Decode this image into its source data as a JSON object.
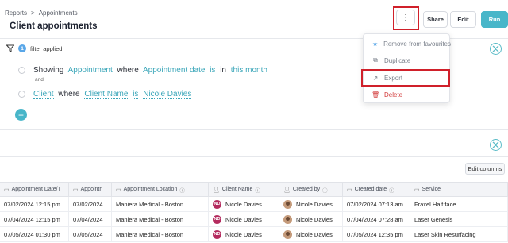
{
  "breadcrumb": {
    "parent": "Reports",
    "separator": ">",
    "current": "Appointments"
  },
  "page": {
    "title": "Client appointments"
  },
  "toolbar": {
    "more_label": "⋮",
    "share_label": "Share",
    "edit_label": "Edit",
    "run_label": "Run"
  },
  "menu": {
    "items": [
      {
        "label": "Remove from favourites",
        "icon": "star-icon"
      },
      {
        "label": "Duplicate",
        "icon": "copy-icon"
      },
      {
        "label": "Export",
        "icon": "export-icon"
      },
      {
        "label": "Delete",
        "icon": "trash-icon"
      }
    ]
  },
  "filters": {
    "count": "1",
    "label": "filter applied",
    "condition1": {
      "w1": "Showing",
      "t1": "Appointment",
      "w2": "where",
      "t2": "Appointment date",
      "t3": "is",
      "w3": "in",
      "t4": "this month"
    },
    "and_label": "and",
    "condition2": {
      "t1": "Client",
      "w1": "where",
      "t2": "Client Name",
      "t3": "is",
      "t4": "Nicole Davies"
    },
    "add_label": "+"
  },
  "table": {
    "edit_columns_label": "Edit columns",
    "headers": [
      "Appointment Date/T",
      "Appointn",
      "Appointment Location",
      "Client Name",
      "Created by",
      "Created date",
      "Service"
    ],
    "rows": [
      [
        "07/02/2024 12:15 pm",
        "07/02/2024",
        "Maniera Medical - Boston",
        "Nicole Davies",
        "Nicole Davies",
        "07/02/2024 07:13 am",
        "Fraxel Half face"
      ],
      [
        "07/04/2024 12:15 pm",
        "07/04/2024",
        "Maniera Medical - Boston",
        "Nicole Davies",
        "Nicole Davies",
        "07/04/2024 07:28 am",
        "Laser Genesis"
      ],
      [
        "07/05/2024 01:30 pm",
        "07/05/2024",
        "Maniera Medical - Boston",
        "Nicole Davies",
        "Nicole Davies",
        "07/05/2024 12:35 pm",
        "Laser Skin Resurfacing"
      ]
    ],
    "client_initials": "ND"
  },
  "colors": {
    "accent": "#48b6c9",
    "highlight": "#d0202a",
    "avatar": "#b42b5e",
    "danger": "#d23838"
  }
}
